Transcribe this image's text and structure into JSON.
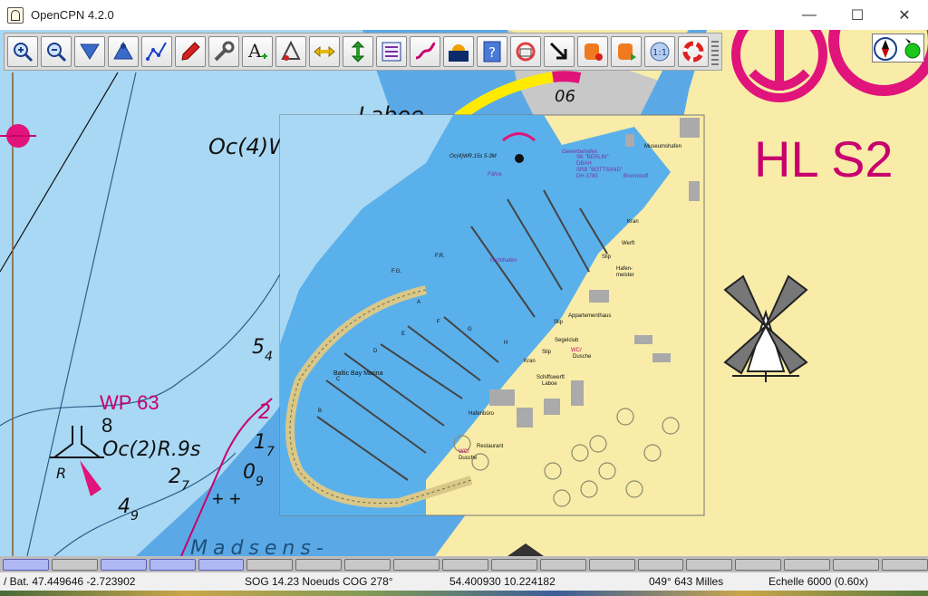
{
  "window": {
    "title": "OpenCPN 4.2.0",
    "minimize": "—",
    "maximize": "☐",
    "close": "✕"
  },
  "toolbar": {
    "tools": [
      {
        "name": "zoom-in-icon"
      },
      {
        "name": "zoom-out-icon"
      },
      {
        "name": "scale-down-icon"
      },
      {
        "name": "scale-up-icon"
      },
      {
        "name": "route-icon"
      },
      {
        "name": "ship-icon"
      },
      {
        "name": "settings-wrench-icon"
      },
      {
        "name": "text-add-icon"
      },
      {
        "name": "ais-target-icon"
      },
      {
        "name": "tide-horizontal-icon"
      },
      {
        "name": "current-vertical-icon"
      },
      {
        "name": "route-manager-icon"
      },
      {
        "name": "track-icon"
      },
      {
        "name": "colorscheme-icon"
      },
      {
        "name": "help-icon"
      },
      {
        "name": "print-icon"
      },
      {
        "name": "course-up-icon"
      },
      {
        "name": "record-plugin-icon"
      },
      {
        "name": "play-plugin-icon"
      },
      {
        "name": "scale-1to1-icon"
      },
      {
        "name": "mob-lifebuoy-icon"
      }
    ],
    "scale_1to1_label": "1:1"
  },
  "chart": {
    "labels": {
      "light_char_1": "Oc(4)W",
      "light_char_2": "Oc(2)R.9s",
      "waypoint": "WP 63",
      "madsens": "Madsens-",
      "hl": "HL S2",
      "laboe": "Laboe",
      "depth_54": "5",
      "depth_54_sub": "4",
      "depth_8": "8",
      "depth_17": "1",
      "depth_17_sub": "7",
      "depth_27": "2",
      "depth_27_sub": "7",
      "depth_09": "0",
      "depth_09_sub": "9",
      "depth_49": "4",
      "depth_49_sub": "9",
      "depth_2": "2",
      "depth_06": "06",
      "beacon_r": "R",
      "plus": "+ +"
    },
    "inset": {
      "marina": "Baltic Bay Marina",
      "museum": "Museumshafen",
      "ship_line1": "SK \"BERLIN\"",
      "ship_line2": "DBAH",
      "ship_line3": "SRB \"BOTTSAND\"",
      "ship_line4": "DH 3780",
      "brennstoff": "Brennstoff",
      "kran1": "Kran",
      "werft": "Werft",
      "slip1": "Slip",
      "hafenmeister_1": "Hafen-",
      "hafenmeister_2": "meister",
      "appartement": "Appartementhaus",
      "slip2": "Slip",
      "segelclub": "Segelclub",
      "slip3": "Slip",
      "wc1": "WC/",
      "dusche1": "Dusche",
      "kran2": "Kran",
      "schiffswerft_1": "Schiffswerft",
      "schiffswerft_2": "Laboe",
      "hafenburo": "Hafenbüro",
      "restaurant": "Restaurant",
      "wc2": "WC/",
      "dusche2": "Dusche",
      "yachthafen": "Yachthafen",
      "gewerbehafen": "Gewerbehafen",
      "fahre": "Fähre",
      "ocwr": "Oc(4)WR.15s 5-3M",
      "fr": "F.R.",
      "fg": "F.G.",
      "pier_a": "A",
      "pier_b": "B",
      "pier_c": "C",
      "pier_d": "D",
      "pier_e": "E",
      "pier_f": "F",
      "pier_g": "G",
      "pier_h": "H"
    }
  },
  "chartbar": {
    "keys": [
      {
        "state": "active"
      },
      {
        "state": "inactive"
      },
      {
        "state": "active"
      },
      {
        "state": "active"
      },
      {
        "state": "active"
      },
      {
        "state": "inactive"
      },
      {
        "state": "inactive"
      },
      {
        "state": "inactive"
      },
      {
        "state": "inactive"
      },
      {
        "state": "inactive"
      },
      {
        "state": "inactive"
      },
      {
        "state": "inactive"
      },
      {
        "state": "inactive"
      },
      {
        "state": "inactive"
      },
      {
        "state": "inactive"
      },
      {
        "state": "inactive"
      },
      {
        "state": "inactive"
      },
      {
        "state": "inactive"
      },
      {
        "state": "inactive"
      }
    ]
  },
  "status": {
    "cursor_position": "/ Bat. 47.449646   -2.723902",
    "sog_cog": "SOG 14.23 Noeuds   COG 278°",
    "ship_position": "54.400930   10.224182",
    "bearing_distance": "049°  643 Milles",
    "scale": "Echelle 6000 (0.60x)"
  },
  "colors": {
    "deep_water": "#a8d8f4",
    "shallow_water": "#5aa9e6",
    "land": "#f8eca8",
    "urban": "#c8c8c8",
    "magenta": "#c8006e",
    "piano_active": "#b0b8f4"
  }
}
